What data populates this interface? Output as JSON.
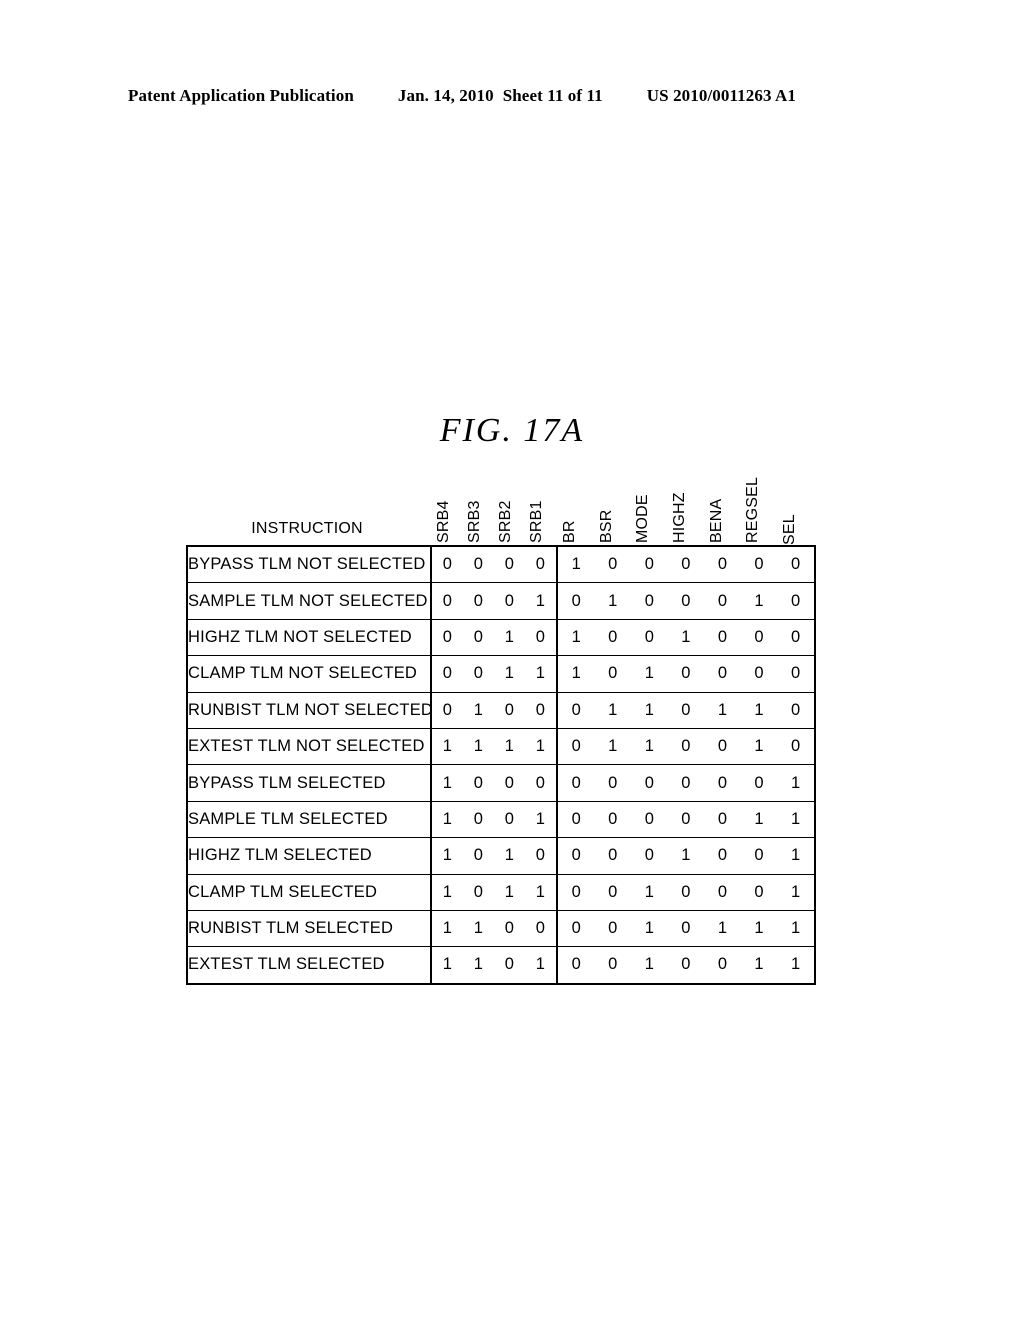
{
  "header": {
    "publication": "Patent Application Publication",
    "date": "Jan. 14, 2010",
    "sheet": "Sheet 11 of 11",
    "number": "US 2010/0011263 A1"
  },
  "figure": {
    "title": "FIG.  17A",
    "instruction_header": "INSTRUCTION"
  },
  "chart_data": {
    "type": "table",
    "title": "FIG.  17A",
    "row_header_label": "INSTRUCTION",
    "column_groups": [
      {
        "name": "srb",
        "columns": [
          "SRB4",
          "SRB3",
          "SRB2",
          "SRB1"
        ]
      },
      {
        "name": "signals",
        "columns": [
          "BR",
          "BSR",
          "MODE",
          "HIGHZ",
          "BENA",
          "REGSEL",
          "SEL"
        ]
      }
    ],
    "columns": [
      "SRB4",
      "SRB3",
      "SRB2",
      "SRB1",
      "BR",
      "BSR",
      "MODE",
      "HIGHZ",
      "BENA",
      "REGSEL",
      "SEL"
    ],
    "rows": [
      {
        "instruction": "BYPASS  TLM  NOT  SELECTED",
        "srb": [
          "0",
          "0",
          "0",
          "0"
        ],
        "signals": [
          "1",
          "0",
          "0",
          "0",
          "0",
          "0",
          "0"
        ]
      },
      {
        "instruction": "SAMPLE  TLM  NOT  SELECTED",
        "srb": [
          "0",
          "0",
          "0",
          "1"
        ],
        "signals": [
          "0",
          "1",
          "0",
          "0",
          "0",
          "1",
          "0"
        ]
      },
      {
        "instruction": "HIGHZ  TLM  NOT  SELECTED",
        "srb": [
          "0",
          "0",
          "1",
          "0"
        ],
        "signals": [
          "1",
          "0",
          "0",
          "1",
          "0",
          "0",
          "0"
        ]
      },
      {
        "instruction": "CLAMP  TLM  NOT  SELECTED",
        "srb": [
          "0",
          "0",
          "1",
          "1"
        ],
        "signals": [
          "1",
          "0",
          "1",
          "0",
          "0",
          "0",
          "0"
        ]
      },
      {
        "instruction": "RUNBIST  TLM  NOT  SELECTED",
        "srb": [
          "0",
          "1",
          "0",
          "0"
        ],
        "signals": [
          "0",
          "1",
          "1",
          "0",
          "1",
          "1",
          "0"
        ]
      },
      {
        "instruction": "EXTEST  TLM  NOT  SELECTED",
        "srb": [
          "1",
          "1",
          "1",
          "1"
        ],
        "signals": [
          "0",
          "1",
          "1",
          "0",
          "0",
          "1",
          "0"
        ]
      },
      {
        "instruction": "BYPASS  TLM  SELECTED",
        "srb": [
          "1",
          "0",
          "0",
          "0"
        ],
        "signals": [
          "0",
          "0",
          "0",
          "0",
          "0",
          "0",
          "1"
        ]
      },
      {
        "instruction": "SAMPLE  TLM  SELECTED",
        "srb": [
          "1",
          "0",
          "0",
          "1"
        ],
        "signals": [
          "0",
          "0",
          "0",
          "0",
          "0",
          "1",
          "1"
        ]
      },
      {
        "instruction": "HIGHZ  TLM  SELECTED",
        "srb": [
          "1",
          "0",
          "1",
          "0"
        ],
        "signals": [
          "0",
          "0",
          "0",
          "1",
          "0",
          "0",
          "1"
        ]
      },
      {
        "instruction": "CLAMP  TLM  SELECTED",
        "srb": [
          "1",
          "0",
          "1",
          "1"
        ],
        "signals": [
          "0",
          "0",
          "1",
          "0",
          "0",
          "0",
          "1"
        ]
      },
      {
        "instruction": "RUNBIST  TLM  SELECTED",
        "srb": [
          "1",
          "1",
          "0",
          "0"
        ],
        "signals": [
          "0",
          "0",
          "1",
          "0",
          "1",
          "1",
          "1"
        ]
      },
      {
        "instruction": "EXTEST  TLM  SELECTED",
        "srb": [
          "1",
          "1",
          "0",
          "1"
        ],
        "signals": [
          "0",
          "0",
          "1",
          "0",
          "0",
          "1",
          "1"
        ]
      }
    ]
  }
}
